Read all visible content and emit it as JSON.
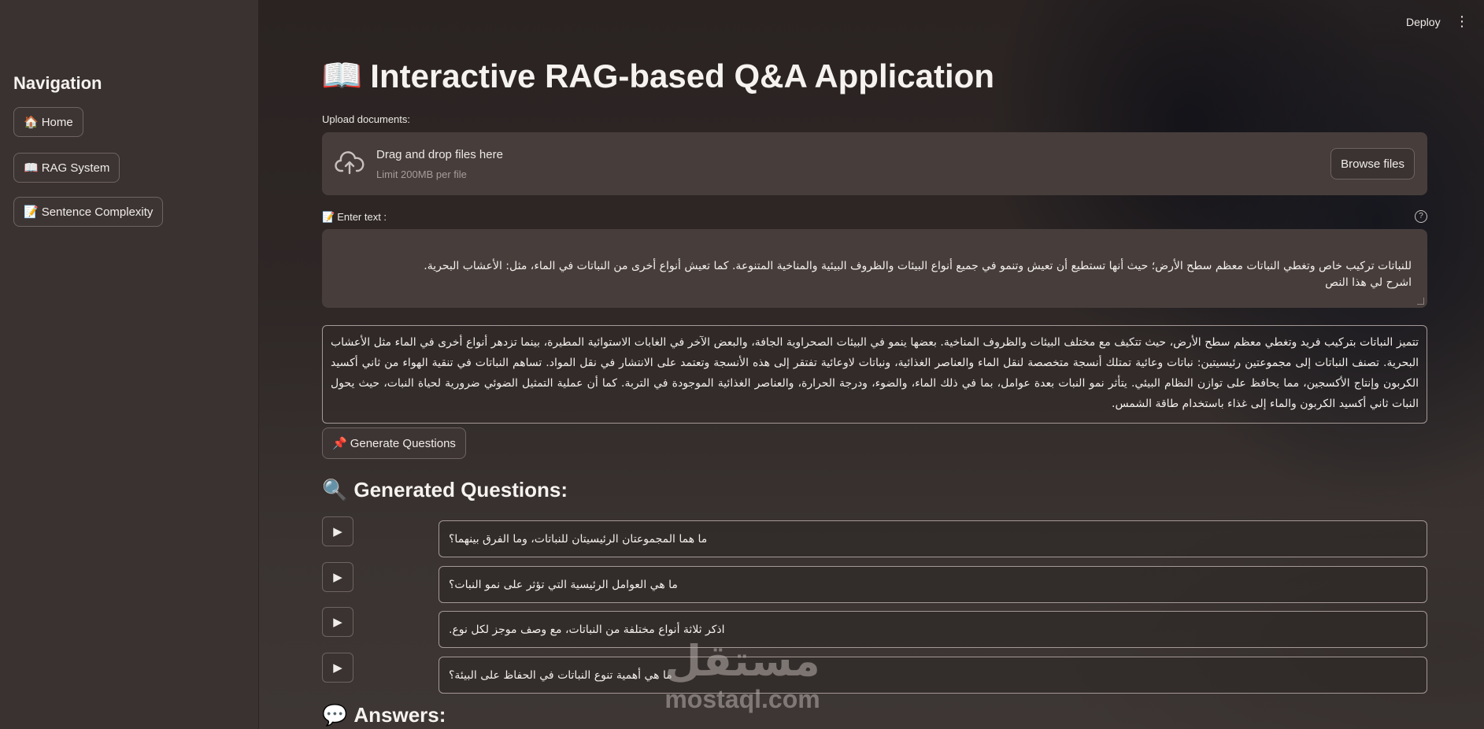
{
  "header": {
    "deploy_label": "Deploy",
    "menu_icon": "more-vertical-icon"
  },
  "sidebar": {
    "title": "Navigation",
    "items": [
      {
        "icon": "🏠",
        "label": "Home"
      },
      {
        "icon": "📖",
        "label": "RAG System"
      },
      {
        "icon": "📝",
        "label": "Sentence Complexity"
      }
    ]
  },
  "main": {
    "title_icon": "📖",
    "title": "Interactive RAG-based Q&A Application",
    "upload": {
      "label": "Upload documents:",
      "drop_text": "Drag and drop files here",
      "limit_text": "Limit 200MB per file",
      "browse_label": "Browse files"
    },
    "text_input": {
      "icon": "📝",
      "label": "Enter text :",
      "value": "للنباتات تركيب خاص وتغطي النباتات معظم سطح الأرض؛ حيث أنها تستطيع أن تعيش وتنمو في جميع أنواع البيئات والظروف البيئية والمناخية المتنوعة. كما تعيش أنواع أخرى من النباتات في الماء، مثل: الأعشاب البحرية.\nاشرح لي هذا النص"
    },
    "explanation": "تتميز النباتات بتركيب فريد وتغطي معظم سطح الأرض، حيث تتكيف مع مختلف البيئات والظروف المناخية. بعضها ينمو في البيئات الصحراوية الجافة، والبعض الآخر في الغابات الاستوائية المطيرة، بينما تزدهر أنواع أخرى في الماء مثل الأعشاب البحرية. تصنف النباتات إلى مجموعتين رئيسيتين: نباتات وعائية تمتلك أنسجة متخصصة لنقل الماء والعناصر الغذائية، ونباتات لاوعائية تفتقر إلى هذه الأنسجة وتعتمد على الانتشار في نقل المواد. تساهم النباتات في تنقية الهواء من ثاني أكسيد الكربون وإنتاج الأكسجين، مما يحافظ على توازن النظام البيئي. يتأثر نمو النبات بعدة عوامل، بما في ذلك الماء، والضوء، ودرجة الحرارة، والعناصر الغذائية الموجودة في التربة. كما أن عملية التمثيل الضوئي ضرورية لحياة النبات، حيث يحول النبات ثاني أكسيد الكربون والماء إلى غذاء باستخدام طاقة الشمس.",
    "generate_button": {
      "icon": "📌",
      "label": "Generate Questions"
    },
    "questions_heading": {
      "icon": "🔍",
      "label": "Generated Questions:"
    },
    "questions": [
      "ما هما المجموعتان الرئيسيتان للنباتات، وما الفرق بينهما؟",
      "ما هي العوامل الرئيسية التي تؤثر على نمو النبات؟",
      "اذكر ثلاثة أنواع مختلفة من النباتات، مع وصف موجز لكل نوع.",
      "ما هي أهمية تنوع النباتات في الحفاظ على البيئة؟"
    ],
    "play_icon": "▶",
    "answers_heading": {
      "icon": "💬",
      "label": "Answers:"
    }
  },
  "watermark": {
    "arabic": "مستقل",
    "latin": "mostaql.com"
  },
  "colors": {
    "sidebar_bg": "#3a3231",
    "input_bg": "#473e3c",
    "border": "#a49a97"
  }
}
